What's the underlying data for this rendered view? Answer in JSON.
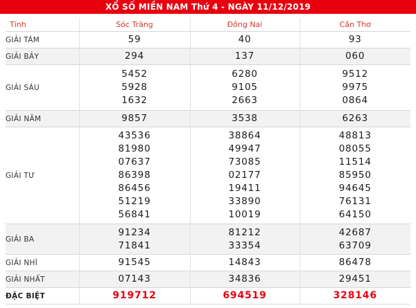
{
  "header": {
    "title": "XỔ SỐ MIỀN NAM Thứ 4 - NGÀY 11/12/2019",
    "bg_color": "#e9000f"
  },
  "table": {
    "columns": [
      "Tỉnh",
      "Sóc Trăng",
      "Đồng Nai",
      "Cần Thơ"
    ],
    "rows": [
      {
        "prize": "GIẢI TÁM",
        "values": [
          [
            "59"
          ],
          [
            "40"
          ],
          [
            "93"
          ]
        ]
      },
      {
        "prize": "GIẢI BẢY",
        "values": [
          [
            "294"
          ],
          [
            "137"
          ],
          [
            "060"
          ]
        ]
      },
      {
        "prize": "GIẢI SÁU",
        "values": [
          [
            "5452",
            "5928",
            "1632"
          ],
          [
            "6280",
            "9105",
            "2663"
          ],
          [
            "9512",
            "9975",
            "0864"
          ]
        ]
      },
      {
        "prize": "GIẢI NĂM",
        "values": [
          [
            "9857"
          ],
          [
            "3538"
          ],
          [
            "6263"
          ]
        ]
      },
      {
        "prize": "GIẢI TƯ",
        "values": [
          [
            "43536",
            "81980",
            "07637",
            "86398",
            "86456",
            "51219",
            "56841"
          ],
          [
            "38864",
            "49947",
            "73085",
            "02177",
            "19411",
            "33890",
            "10019"
          ],
          [
            "48813",
            "08055",
            "11514",
            "85950",
            "94645",
            "76131",
            "64150"
          ]
        ]
      },
      {
        "prize": "GIẢI BA",
        "values": [
          [
            "91234",
            "71841"
          ],
          [
            "81212",
            "33354"
          ],
          [
            "42687",
            "63709"
          ]
        ]
      },
      {
        "prize": "GIẢI NHÌ",
        "values": [
          [
            "91545"
          ],
          [
            "14843"
          ],
          [
            "86478"
          ]
        ]
      },
      {
        "prize": "GIẢI NHẤT",
        "values": [
          [
            "07143"
          ],
          [
            "34836"
          ],
          [
            "29451"
          ]
        ]
      },
      {
        "prize": "ĐẶC BIỆT",
        "values": [
          [
            "919712"
          ],
          [
            "694519"
          ],
          [
            "328146"
          ]
        ]
      }
    ],
    "special_color": "#e9000f"
  }
}
